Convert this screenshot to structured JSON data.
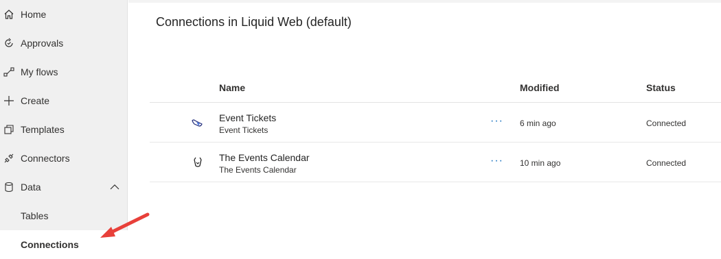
{
  "sidebar": {
    "items": [
      {
        "label": "Home",
        "icon": "home-icon"
      },
      {
        "label": "Approvals",
        "icon": "approvals-icon"
      },
      {
        "label": "My flows",
        "icon": "flows-icon"
      },
      {
        "label": "Create",
        "icon": "plus-icon"
      },
      {
        "label": "Templates",
        "icon": "templates-icon"
      },
      {
        "label": "Connectors",
        "icon": "connector-icon"
      },
      {
        "label": "Data",
        "icon": "database-icon"
      },
      {
        "label": "Tables"
      },
      {
        "label": "Connections"
      }
    ]
  },
  "main": {
    "title": "Connections in Liquid Web (default)",
    "columns": {
      "name": "Name",
      "modified": "Modified",
      "status": "Status"
    },
    "rows": [
      {
        "name": "Event Tickets",
        "subname": "Event Tickets",
        "more": "···",
        "modified": "6 min ago",
        "status": "Connected",
        "icon": "ticket-icon"
      },
      {
        "name": "The Events Calendar",
        "subname": "The Events Calendar",
        "more": "···",
        "modified": "10 min ago",
        "status": "Connected",
        "icon": "calendar-icon"
      }
    ]
  },
  "colors": {
    "accent": "#0f6cbd",
    "arrow": "#e8403a",
    "sidebar_bg": "#f0f0f0"
  }
}
